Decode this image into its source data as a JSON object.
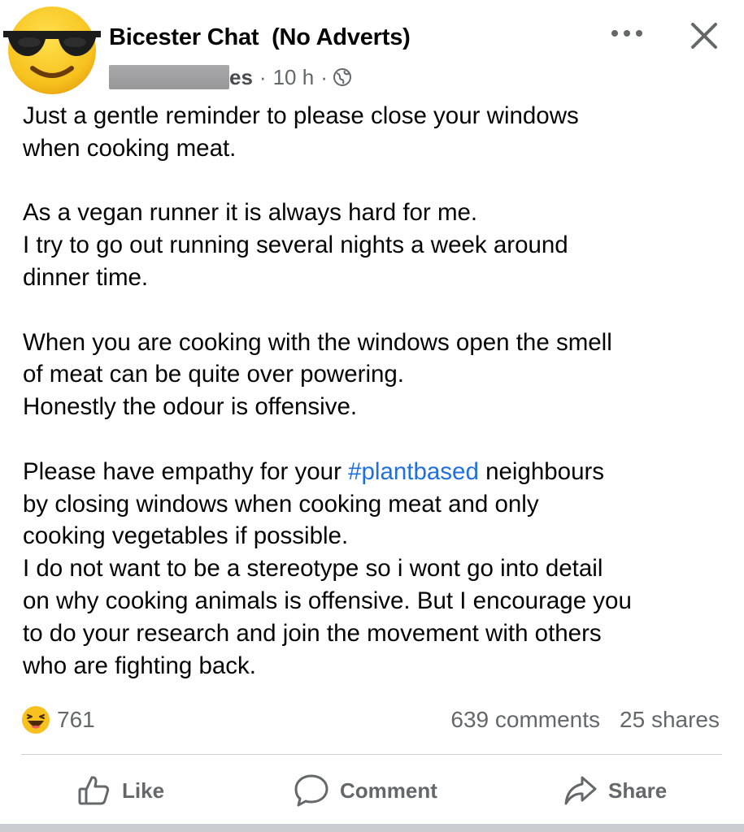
{
  "post": {
    "group_name": "Bicester Chat  (No Adverts)",
    "author_suffix": "es",
    "separator": "·",
    "timestamp": "10 h",
    "privacy_icon": "globe-icon",
    "more_icon": "more-horizontal-icon",
    "close_icon": "close-icon",
    "avatar_icon": "sunglasses-emoji-icon",
    "paragraphs": [
      [
        "Just a gentle reminder to please close your windows",
        "when cooking meat."
      ],
      [
        "As a vegan runner it is always hard for me.",
        "I try to go out running several nights a week around",
        "dinner time."
      ],
      [
        "When you are cooking with the windows open the smell",
        "of meat can be quite over powering.",
        "Honestly the odour is offensive."
      ]
    ],
    "last_paragraph": {
      "line1_before": "Please have empathy for your ",
      "hashtag": "#plantbased",
      "line1_after": " neighbours",
      "lines": [
        "by closing windows when cooking meat and only",
        "cooking vegetables if possible.",
        "I do not want to be a stereotype so i wont go into detail",
        "on why cooking animals is offensive. But I encourage you",
        "to do your research and join the movement with others",
        "who are fighting back."
      ]
    }
  },
  "engagement": {
    "reaction_icon": "haha-emoji-icon",
    "reaction_count": "761",
    "comments": "639 comments",
    "shares": "25 shares"
  },
  "actions": {
    "like_label": "Like",
    "comment_label": "Comment",
    "share_label": "Share"
  },
  "colors": {
    "hashtag": "#216fdb",
    "secondary_text": "#65676b",
    "emoji_yellow": "#f7c21e"
  }
}
